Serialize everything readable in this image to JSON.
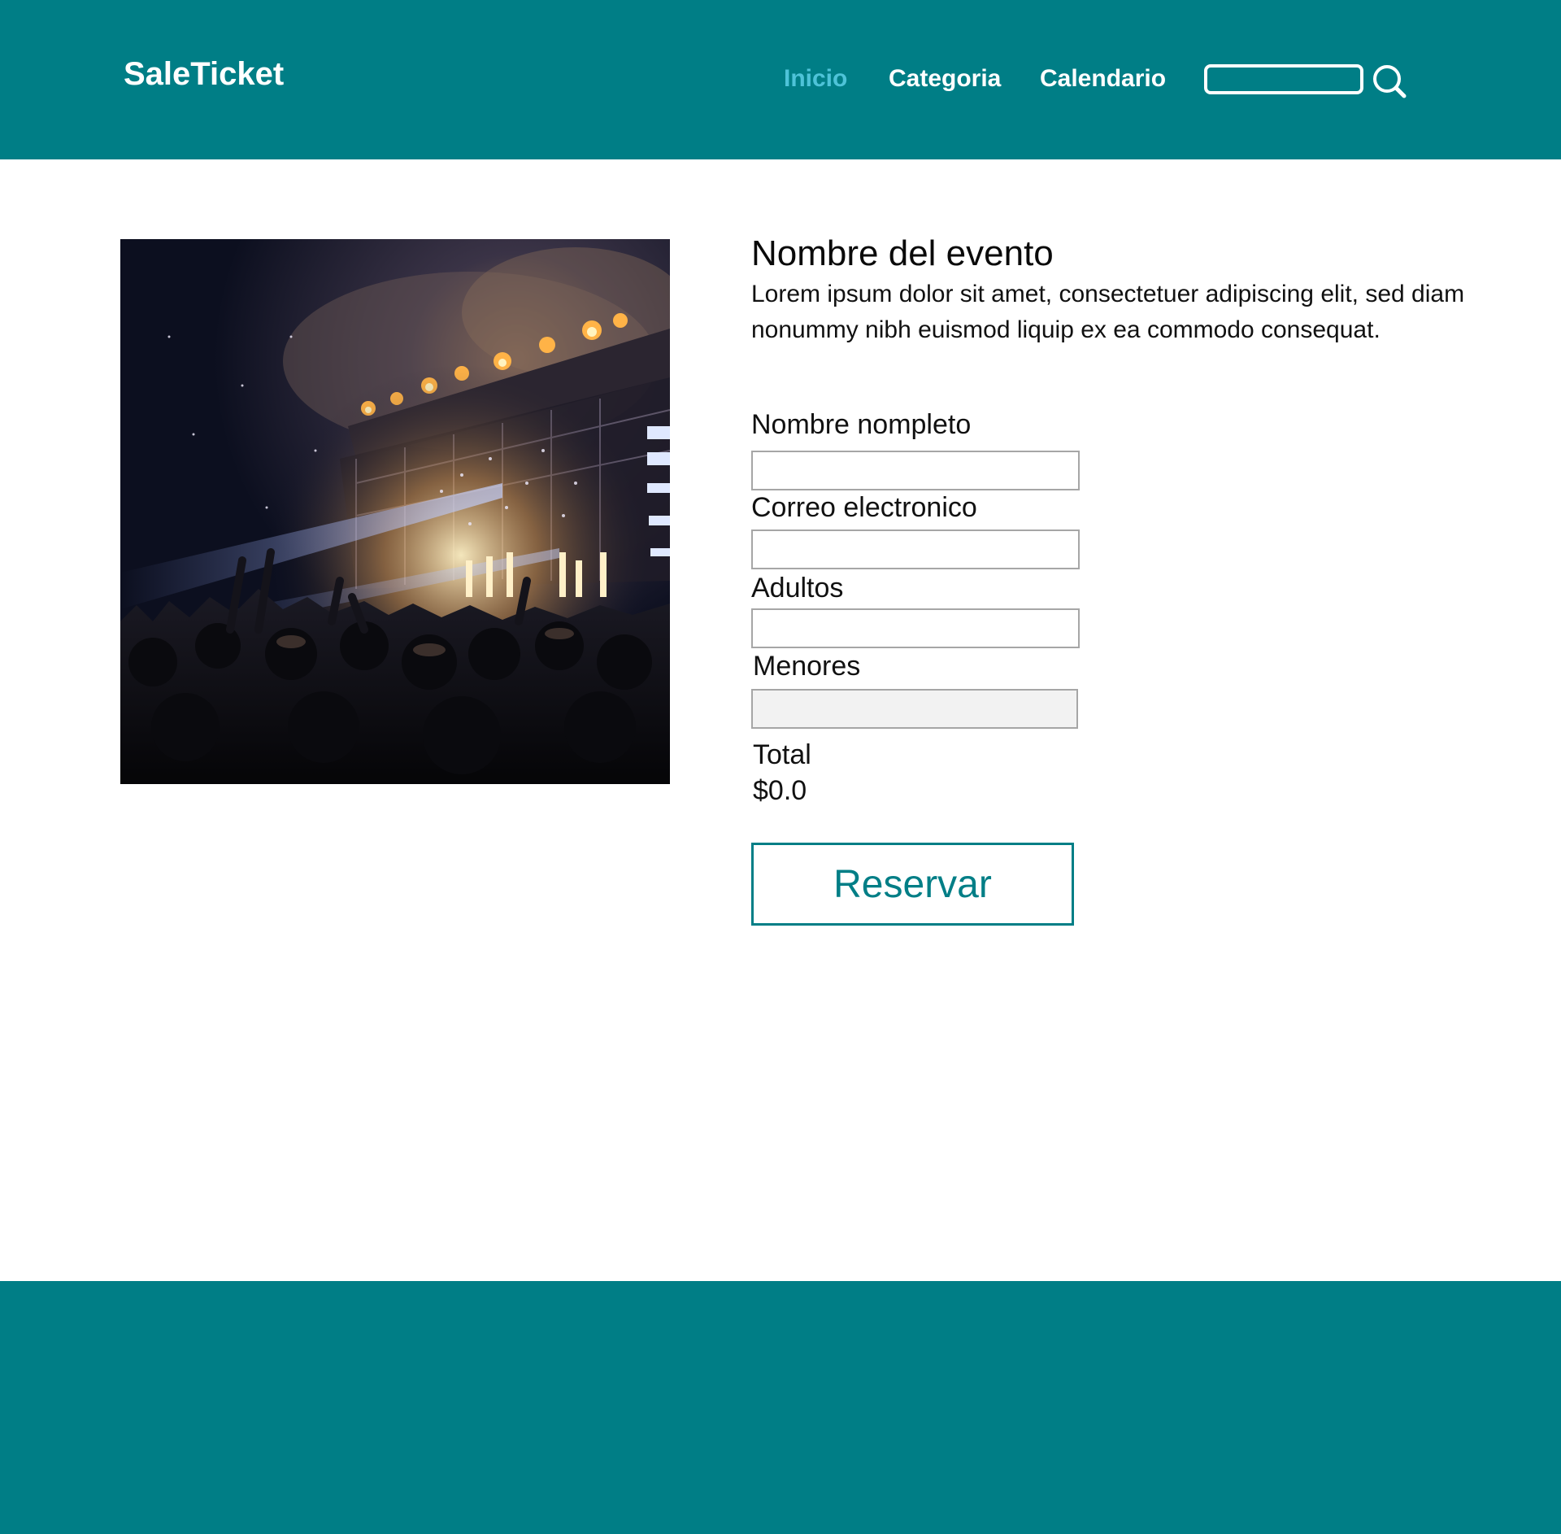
{
  "header": {
    "brand": "SaleTicket",
    "nav": {
      "inicio": "Inicio",
      "categoria": "Categoria",
      "calendario": "Calendario"
    },
    "search": {
      "value": "",
      "icon": "search-icon"
    }
  },
  "event": {
    "title": "Nombre del evento",
    "description": "Lorem ipsum dolor sit amet, consectetuer adipiscing elit, sed diam nonummy nibh euismod liquip ex ea commodo consequat."
  },
  "form": {
    "nombre_label": "Nombre nompleto",
    "nombre_value": "",
    "correo_label": "Correo electronico",
    "correo_value": "",
    "adultos_label": "Adultos",
    "adultos_value": "",
    "menores_label": "Menores",
    "menores_value": "",
    "total_label": "Total",
    "total_value": "$0.0",
    "reserve_label": "Reservar"
  },
  "colors": {
    "primary": "#007e86",
    "nav_active": "#4ec3d8",
    "input_border": "#a6a6a6",
    "disabled_input": "#f2f2f2"
  }
}
